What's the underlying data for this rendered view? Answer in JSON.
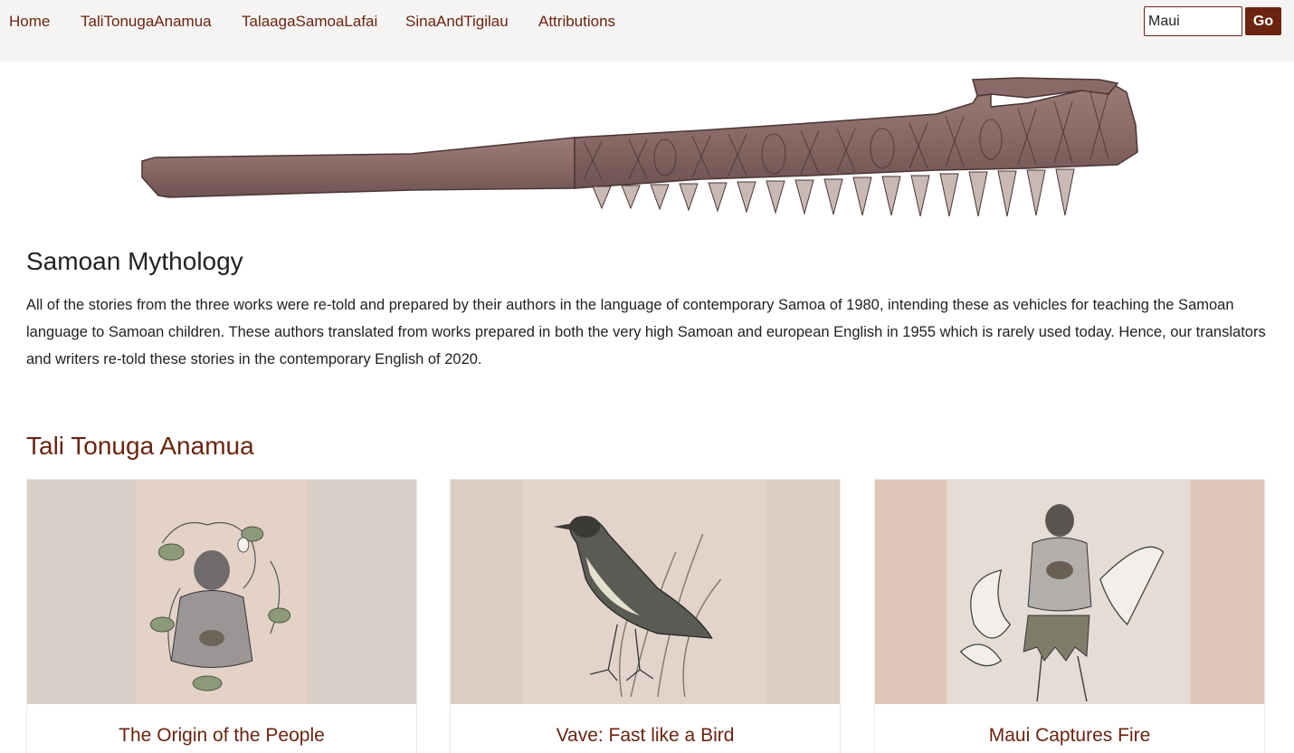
{
  "nav": {
    "links": [
      "Home",
      "TaliTonugaAnamua",
      "TalaagaSamoaLafai",
      "SinaAndTigilau",
      "Attributions"
    ],
    "search_value": "Maui",
    "go_label": "Go"
  },
  "main": {
    "title": "Samoan Mythology",
    "intro": "All of the stories from the three works were re-told and prepared by their authors in the language of contemporary Samoa of 1980, intending these as vehicles for teaching the Samoan language to Samoan children. These authors translated from works prepared in both the very high Samoan and european English in 1955 which is rarely used today. Hence, our translators and writers re-told these stories in the contemporary English of 2020.",
    "section_heading": "Tali Tonuga Anamua",
    "cards": [
      {
        "title": "The Origin of the People",
        "icon": "seated-man-with-vines-illustration"
      },
      {
        "title": "Vave: Fast like a Bird",
        "icon": "bird-illustration"
      },
      {
        "title": "Maui Captures Fire",
        "icon": "maui-with-fire-illustration"
      }
    ]
  },
  "colors": {
    "accent": "#6a2410",
    "nav_bg": "#f6f4f3",
    "card_bg_1": "#d9cfc6",
    "card_bg_2": "#dccdc0",
    "card_bg_3": "#dfc8b9"
  },
  "hero": {
    "icon": "carved-wooden-club-illustration"
  }
}
